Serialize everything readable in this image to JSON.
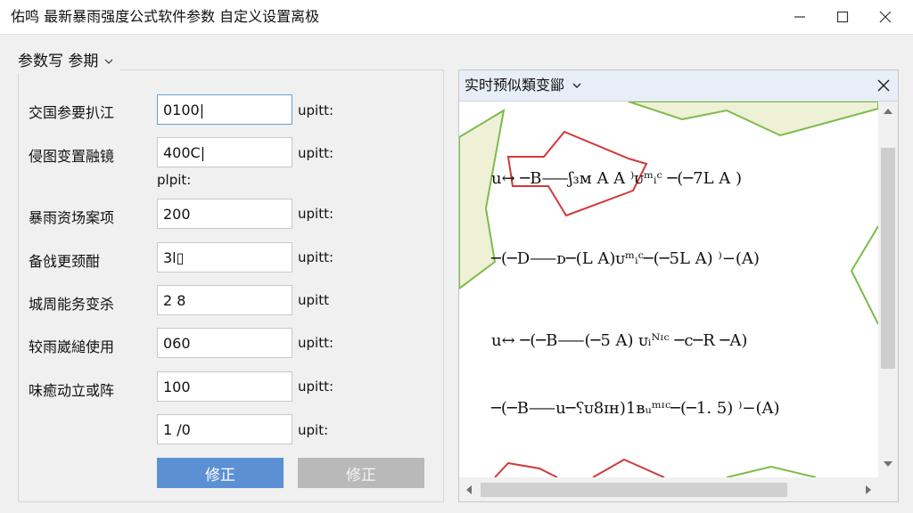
{
  "window": {
    "title": "佑鸣   最新暴雨强度公式软件参数 自定义设置离极",
    "controls": {
      "minimize": "minimize-icon",
      "maximize": "maximize-icon",
      "close": "close-icon"
    }
  },
  "params": {
    "group_title": "参数写  参期",
    "rows": [
      {
        "label": "交国参要扒江",
        "value": "0100|",
        "unit": "upitt:"
      },
      {
        "label": "侵图变置融镜",
        "value": "400C|",
        "unit": "upitt:"
      },
      {
        "label": "暴雨资场案项",
        "value": "200",
        "unit": "upitt:"
      },
      {
        "label": "备戗更颈酣",
        "value": "3l▯",
        "unit": "upitt:"
      },
      {
        "label": "城周能务变杀",
        "value": "2 8",
        "unit": "upitt"
      },
      {
        "label": "较雨崴縋使用",
        "value": "060",
        "unit": "upitt:"
      },
      {
        "label": "味癒动立或阵",
        "value": "100",
        "unit": "upitt:"
      },
      {
        "label": "",
        "value": "1 /0",
        "unit": "upit:"
      }
    ],
    "extra_unit": "plpit:",
    "buttons": {
      "primary": "修正",
      "secondary": "修正"
    }
  },
  "preview": {
    "title": "实时预似類变䣎",
    "formulas": [
      "u↔ ─B⸺ʃ₃ᴍ A  A   ⁾ᴜᵐᵢᶜ ─(─7L   A )",
      "─(─D⸺ᴅ─(L  A)ᴜᵐᵢᶜ─(─5L   A)  ⁾−(A)",
      "u↔ ─(─B⸺(─5   A)   ᴜᵢᴺᶦᶜ ─c─R  ─A)",
      "─(─B⸺u─⸮ᴜ8ɪʜ)1ʙᵤᵐᶦᶜ─(─1.  5)  ⁾−(A)"
    ]
  },
  "colors": {
    "accent": "#5b91d2",
    "disabled": "#b9b9b9",
    "preview_header": "#e8eef8",
    "diagram_red": "#cf3a3a",
    "diagram_green": "#7dbb4a",
    "diagram_fill": "#eef1d6"
  }
}
